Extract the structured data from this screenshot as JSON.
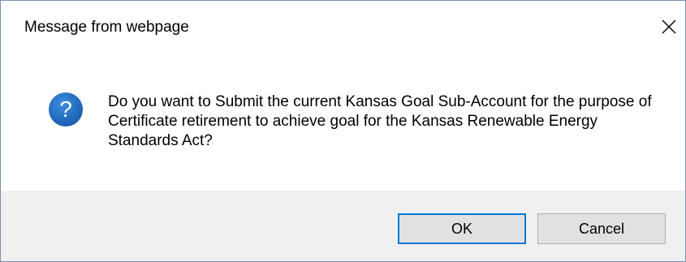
{
  "dialog": {
    "title": "Message from webpage",
    "close_icon": "close-icon",
    "message_icon": "question-icon",
    "message": "Do you want to Submit the current Kansas Goal Sub-Account for the purpose of Certificate retirement to achieve goal for the Kansas Renewable Energy Standards Act?",
    "ok_label": "OK",
    "cancel_label": "Cancel"
  },
  "colors": {
    "icon_blue": "#1f66b3",
    "focus_border": "#0078d7",
    "footer_bg": "#f0f0f0",
    "button_bg": "#e1e1e1"
  }
}
